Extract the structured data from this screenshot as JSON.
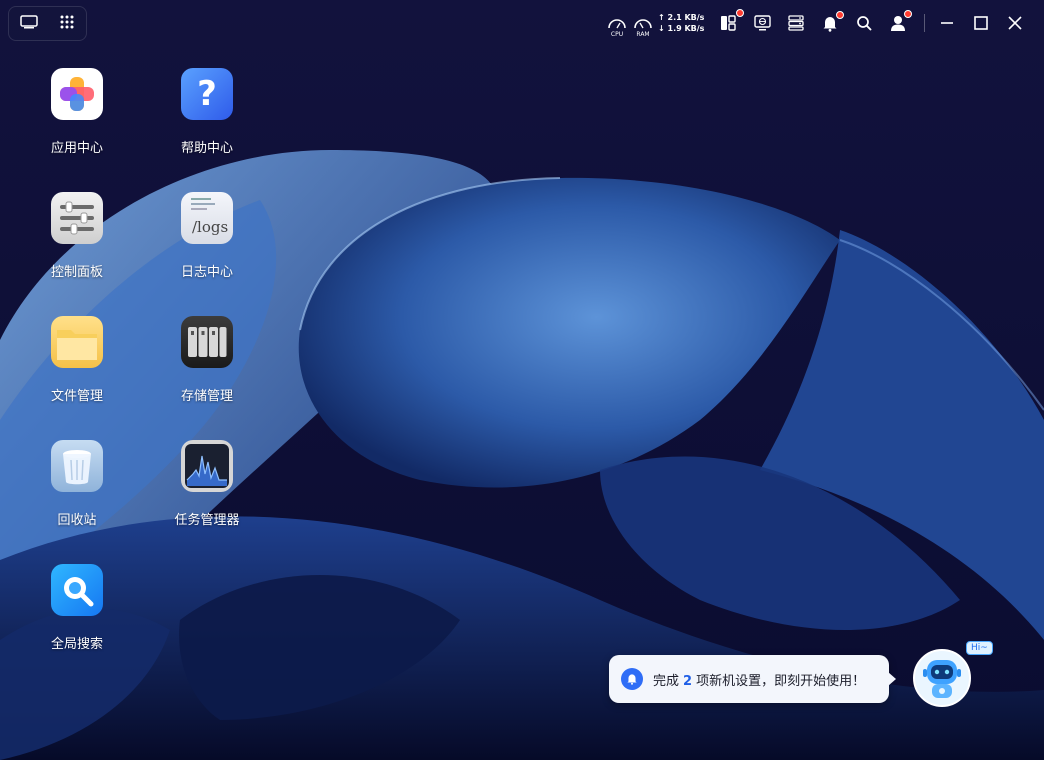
{
  "topbar": {
    "left_buttons": [
      {
        "name": "show-desktop-icon"
      },
      {
        "name": "app-grid-icon"
      }
    ],
    "cpu_label": "CPU",
    "ram_label": "RAM",
    "net_up": "2.1 KB/s",
    "net_down": "1.9 KB/s",
    "net_up_arrow": "↑",
    "net_down_arrow": "↓"
  },
  "desktop_icons": [
    {
      "label": "应用中心",
      "icon": "app-center-icon"
    },
    {
      "label": "帮助中心",
      "icon": "help-center-icon",
      "glyph": "?"
    },
    {
      "label": "控制面板",
      "icon": "control-panel-icon"
    },
    {
      "label": "日志中心",
      "icon": "log-center-icon",
      "glyph": "/logs"
    },
    {
      "label": "文件管理",
      "icon": "file-manager-icon"
    },
    {
      "label": "存储管理",
      "icon": "storage-manager-icon"
    },
    {
      "label": "回收站",
      "icon": "recycle-bin-icon"
    },
    {
      "label": "任务管理器",
      "icon": "task-manager-icon"
    },
    {
      "label": "全局搜索",
      "icon": "global-search-icon"
    }
  ],
  "notification": {
    "prefix": "完成",
    "count": "2",
    "suffix": "项新机设置，即刻开始使用！"
  },
  "assistant": {
    "greeting": "Hi~"
  },
  "colors": {
    "accent": "#2f6df6",
    "badge": "#ff3b30",
    "background": "#0b0d33"
  }
}
